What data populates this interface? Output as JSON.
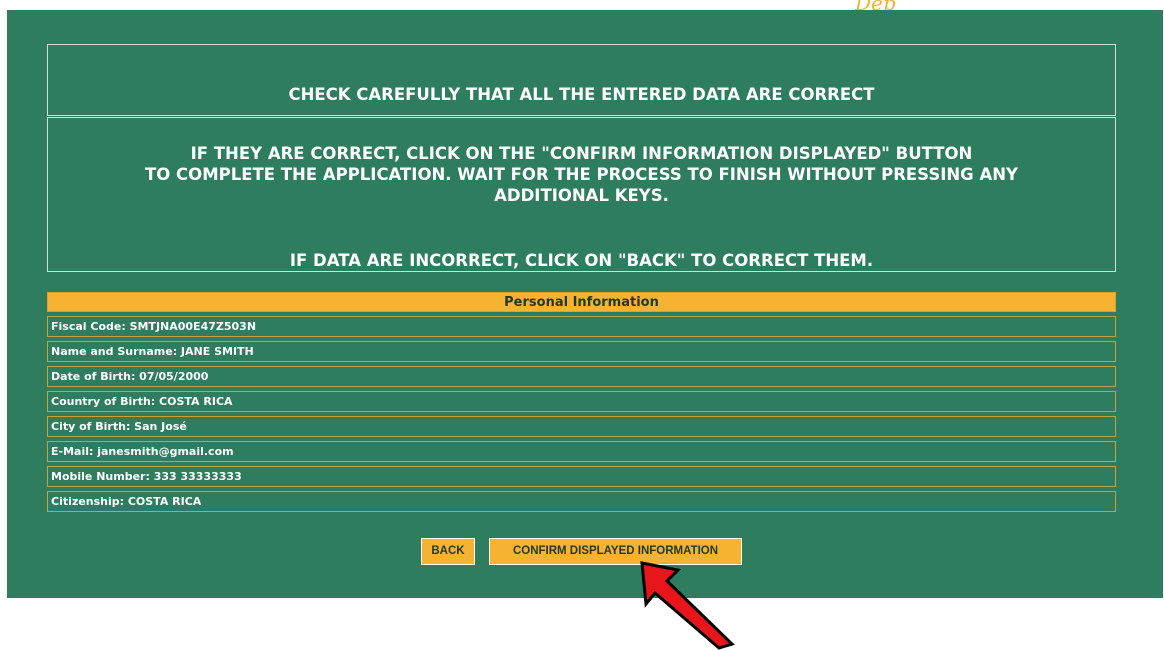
{
  "header": {
    "logo_fragment": "Dep"
  },
  "notice": {
    "heading": "CHECK CAREFULLY THAT ALL THE ENTERED DATA ARE CORRECT",
    "instruction_line1": "IF THEY ARE CORRECT, CLICK ON THE \"CONFIRM INFORMATION DISPLAYED\" BUTTON",
    "instruction_line2": "TO COMPLETE THE APPLICATION. WAIT FOR THE PROCESS TO FINISH WITHOUT PRESSING ANY",
    "instruction_line3": "ADDITIONAL KEYS.",
    "incorrect_line": "IF DATA ARE INCORRECT, CLICK ON \"BACK\" TO CORRECT THEM."
  },
  "personal_info": {
    "title": "Personal Information",
    "rows": [
      "Fiscal Code: SMTJNA00E47Z503N",
      "Name and Surname: JANE SMITH",
      "Date of Birth: 07/05/2000",
      "Country of Birth: COSTA RICA",
      "City of Birth: San José",
      "E-Mail: janesmith@gmail.com",
      "Mobile Number: 333 33333333",
      "Citizenship: COSTA RICA"
    ]
  },
  "buttons": {
    "back": "BACK",
    "confirm": "CONFIRM DISPLAYED INFORMATION"
  },
  "colors": {
    "panel": "#2e7d5e",
    "accent": "#f6b333",
    "arrow": "#e8151b"
  }
}
